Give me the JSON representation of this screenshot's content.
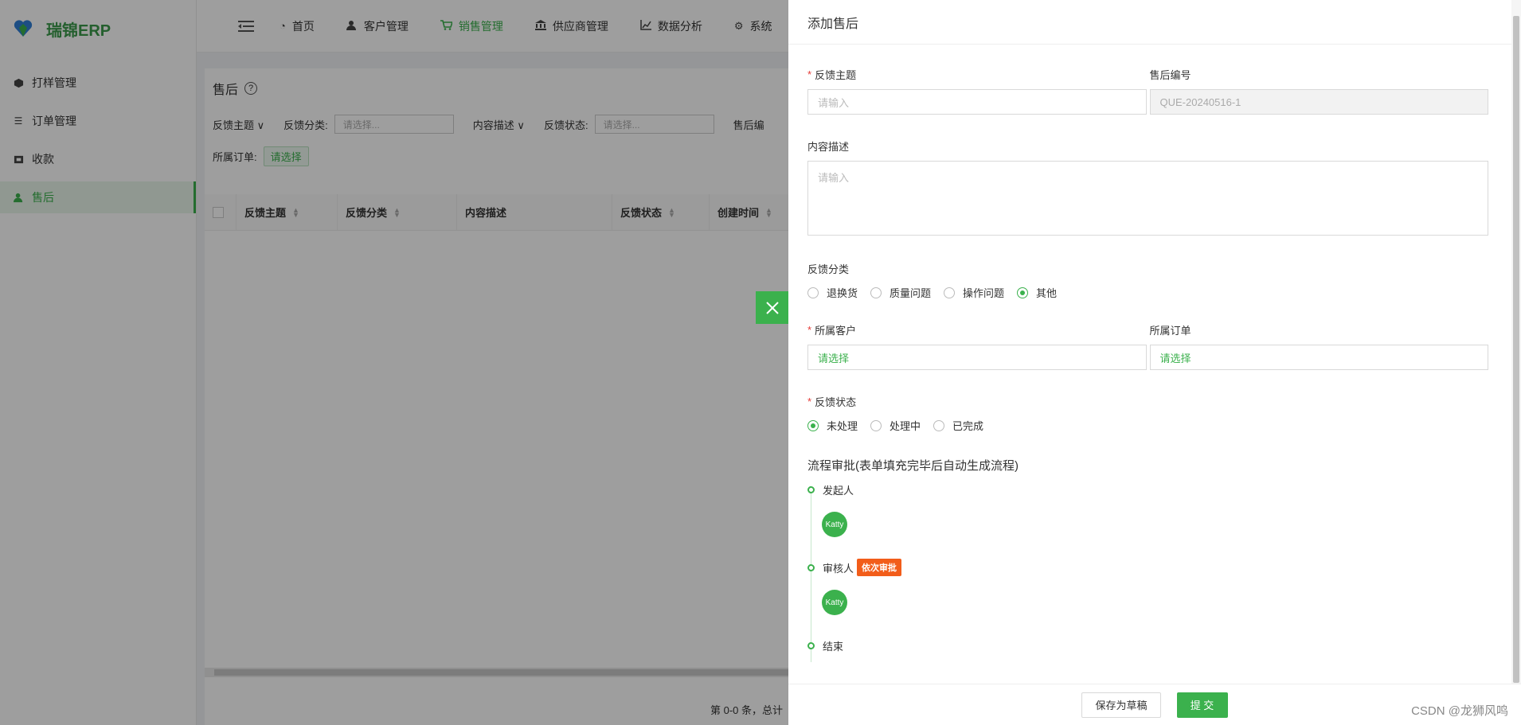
{
  "app": {
    "name": "瑞锦ERP",
    "brand_color": "#3bb14d"
  },
  "sidebar": {
    "items": [
      {
        "label": "打样管理",
        "icon": "box-icon"
      },
      {
        "label": "订单管理",
        "icon": "list-icon"
      },
      {
        "label": "收款",
        "icon": "money-icon"
      },
      {
        "label": "售后",
        "icon": "user-icon",
        "active": true
      }
    ]
  },
  "topnav": {
    "items": [
      {
        "label": "首页",
        "icon": "dashboard-icon"
      },
      {
        "label": "客户管理",
        "icon": "customer-icon"
      },
      {
        "label": "销售管理",
        "icon": "cart-icon",
        "active": true
      },
      {
        "label": "供应商管理",
        "icon": "bank-icon"
      },
      {
        "label": "数据分析",
        "icon": "chart-icon"
      },
      {
        "label": "系统",
        "icon": "gear-icon"
      }
    ]
  },
  "page": {
    "title": "售后",
    "filters": {
      "subject": "反馈主题",
      "category_label": "反馈分类:",
      "category_placeholder": "请选择...",
      "desc": "内容描述",
      "status_label": "反馈状态:",
      "status_placeholder": "请选择...",
      "more": "售后编",
      "order_label": "所属订单:",
      "order_button": "请选择"
    },
    "table": {
      "columns": [
        "反馈主题",
        "反馈分类",
        "内容描述",
        "反馈状态",
        "创建时间"
      ]
    },
    "pager": "第 0-0 条，总计"
  },
  "drawer": {
    "title": "添加售后",
    "subject": {
      "label": "反馈主题",
      "placeholder": "请输入",
      "required": true
    },
    "number": {
      "label": "售后编号",
      "value": "QUE-20240516-1"
    },
    "description": {
      "label": "内容描述",
      "placeholder": "请输入"
    },
    "category": {
      "label": "反馈分类",
      "options": [
        "退换货",
        "质量问题",
        "操作问题",
        "其他"
      ],
      "selected": "其他"
    },
    "customer": {
      "label": "所属客户",
      "value": "请选择",
      "required": true
    },
    "order": {
      "label": "所属订单",
      "value": "请选择"
    },
    "status": {
      "label": "反馈状态",
      "required": true,
      "options": [
        "未处理",
        "处理中",
        "已完成"
      ],
      "selected": "未处理"
    },
    "flow": {
      "title": "流程审批(表单填充完毕后自动生成流程)",
      "initiator_label": "发起人",
      "initiator_avatar": "Katty",
      "reviewer_label": "审核人",
      "reviewer_tag": "依次审批",
      "reviewer_avatar": "Katty",
      "end_label": "结束"
    },
    "buttons": {
      "draft": "保存为草稿",
      "submit": "提 交"
    }
  },
  "watermark": "CSDN @龙狮风鸣"
}
